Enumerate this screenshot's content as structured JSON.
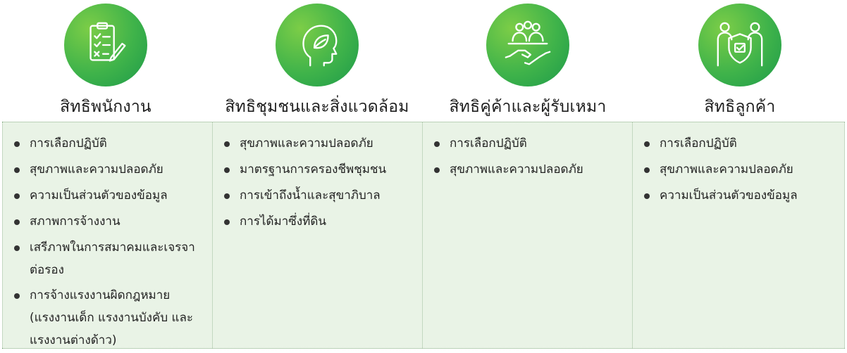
{
  "columns": [
    {
      "title": "สิทธิพนักงาน",
      "icon": "clipboard-checklist-icon",
      "items": [
        "การเลือกปฏิบัติ",
        "สุขภาพและความปลอดภัย",
        "ความเป็นส่วนตัวของข้อมูล",
        "สภาพการจ้างงาน",
        "เสรีภาพในการสมาคมและเจรจาต่อรอง",
        "การจ้างแรงงานผิดกฎหมาย (แรงงานเด็ก แรงงานบังคับ และแรงงานต่างด้าว)"
      ]
    },
    {
      "title": "สิทธิชุมชนและสิ่งแวดล้อม",
      "icon": "head-leaf-icon",
      "items": [
        "สุขภาพและความปลอดภัย",
        "มาตรฐานการครองชีพชุมชน",
        "การเข้าถึงน้ำและสุขาภิบาล",
        "การได้มาซึ่งที่ดิน"
      ]
    },
    {
      "title": "สิทธิคู่ค้าและผู้รับเหมา",
      "icon": "group-handshake-icon",
      "items": [
        "การเลือกปฏิบัติ",
        "สุขภาพและความปลอดภัย"
      ]
    },
    {
      "title": "สิทธิลูกค้า",
      "icon": "people-shield-icon",
      "items": [
        "การเลือกปฏิบัติ",
        "สุขภาพและความปลอดภัย",
        "ความเป็นส่วนตัวของข้อมูล"
      ]
    }
  ],
  "colors": {
    "icon_circle": "#3fb34a",
    "table_bg": "#e9f3e6",
    "divider": "#9ebd9c"
  }
}
